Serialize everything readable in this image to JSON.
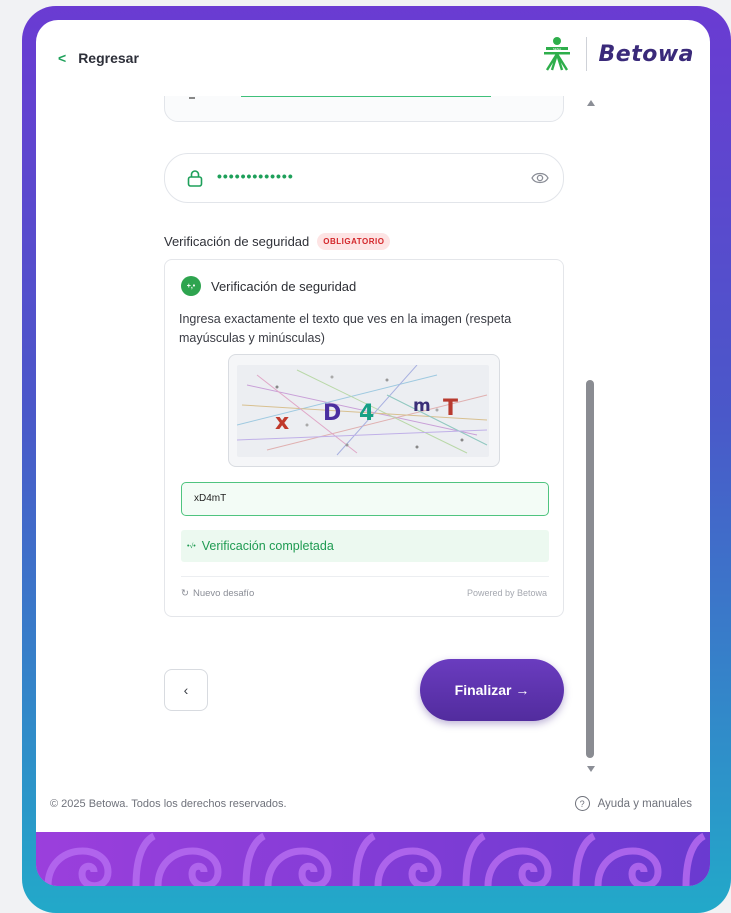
{
  "header": {
    "back_label": "Regresar",
    "brand_name": "Betowa",
    "brand_logo_text": "SENA"
  },
  "form": {
    "password_mask": "•••••••••••••",
    "security_label": "Verificación de seguridad",
    "required_badge": "OBLIGATORIO"
  },
  "captcha": {
    "logo_text": "+,•",
    "title": "Verificación de seguridad",
    "instructions": "Ingresa exactamente el texto que ves en la imagen (respeta mayúsculas y minúsculas)",
    "characters": [
      {
        "char": "x",
        "color": "#c0392b"
      },
      {
        "char": "D",
        "color": "#4a2fa0"
      },
      {
        "char": "4",
        "color": "#16a085"
      },
      {
        "char": "m",
        "color": "#3a2f78"
      },
      {
        "char": "T",
        "color": "#b83a2f"
      }
    ],
    "input_value": "xD4mT",
    "status_icon": "•√•",
    "status_text": "Verificación completada",
    "new_challenge": "Nuevo desafío",
    "powered_by": "Powered by Betowa"
  },
  "nav": {
    "prev_icon": "‹",
    "finish_label": "Finalizar →"
  },
  "footer": {
    "copyright": "© 2025 Betowa. Todos los derechos reservados.",
    "help_icon": "?",
    "help_label": "Ayuda y manuales"
  },
  "colors": {
    "accent_green": "#1ea05a",
    "brand_purple": "#5a2fa8",
    "required_red": "#d3262a"
  },
  "icons": [
    "chevron-left-icon",
    "sena-logo-icon",
    "lock-icon",
    "eye-icon",
    "captcha-logo-icon",
    "refresh-icon",
    "help-icon"
  ]
}
